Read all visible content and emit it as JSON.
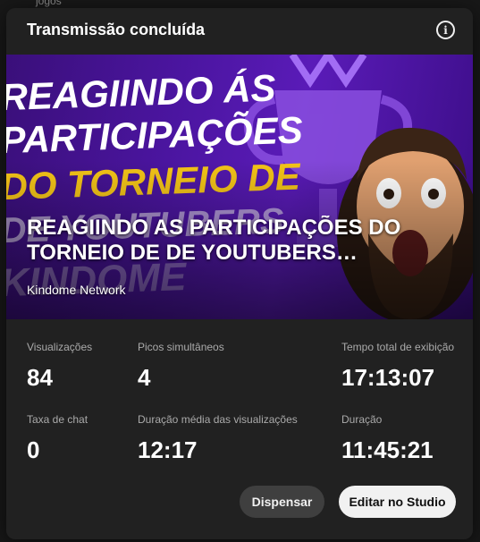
{
  "backdrop": {
    "peek_text": "jogos"
  },
  "dialog": {
    "title": "Transmissão concluída",
    "info_icon": "info-icon"
  },
  "video": {
    "thumbnail_text": [
      "REAGIINDO ÁS",
      "PARTICIPAÇÕES",
      "DO TORNEIO DE",
      "DE YOUTUBERS",
      "KINDOME"
    ],
    "title": "REAGIINDO AS PARTICIPAÇÕES DO TORNEIO DE DE YOUTUBERS…",
    "channel": "Kindome Network"
  },
  "stats": {
    "views": {
      "label": "Visualizações",
      "value": "84"
    },
    "peak": {
      "label": "Picos simultâneos",
      "value": "4"
    },
    "watch_time": {
      "label": "Tempo total de exibição",
      "value": "17:13:07"
    },
    "chat_rate": {
      "label": "Taxa de chat",
      "value": "0"
    },
    "avg_duration": {
      "label": "Duração média das visualizações",
      "value": "12:17"
    },
    "duration": {
      "label": "Duração",
      "value": "11:45:21"
    }
  },
  "actions": {
    "dismiss": "Dispensar",
    "studio": "Editar no Studio"
  },
  "colors": {
    "card": "#212121",
    "thumb_purple": "#4b15a0",
    "thumb_yellow": "#f5c518",
    "button_dark": "#3f3f3f",
    "button_light": "#f1f1f1"
  }
}
